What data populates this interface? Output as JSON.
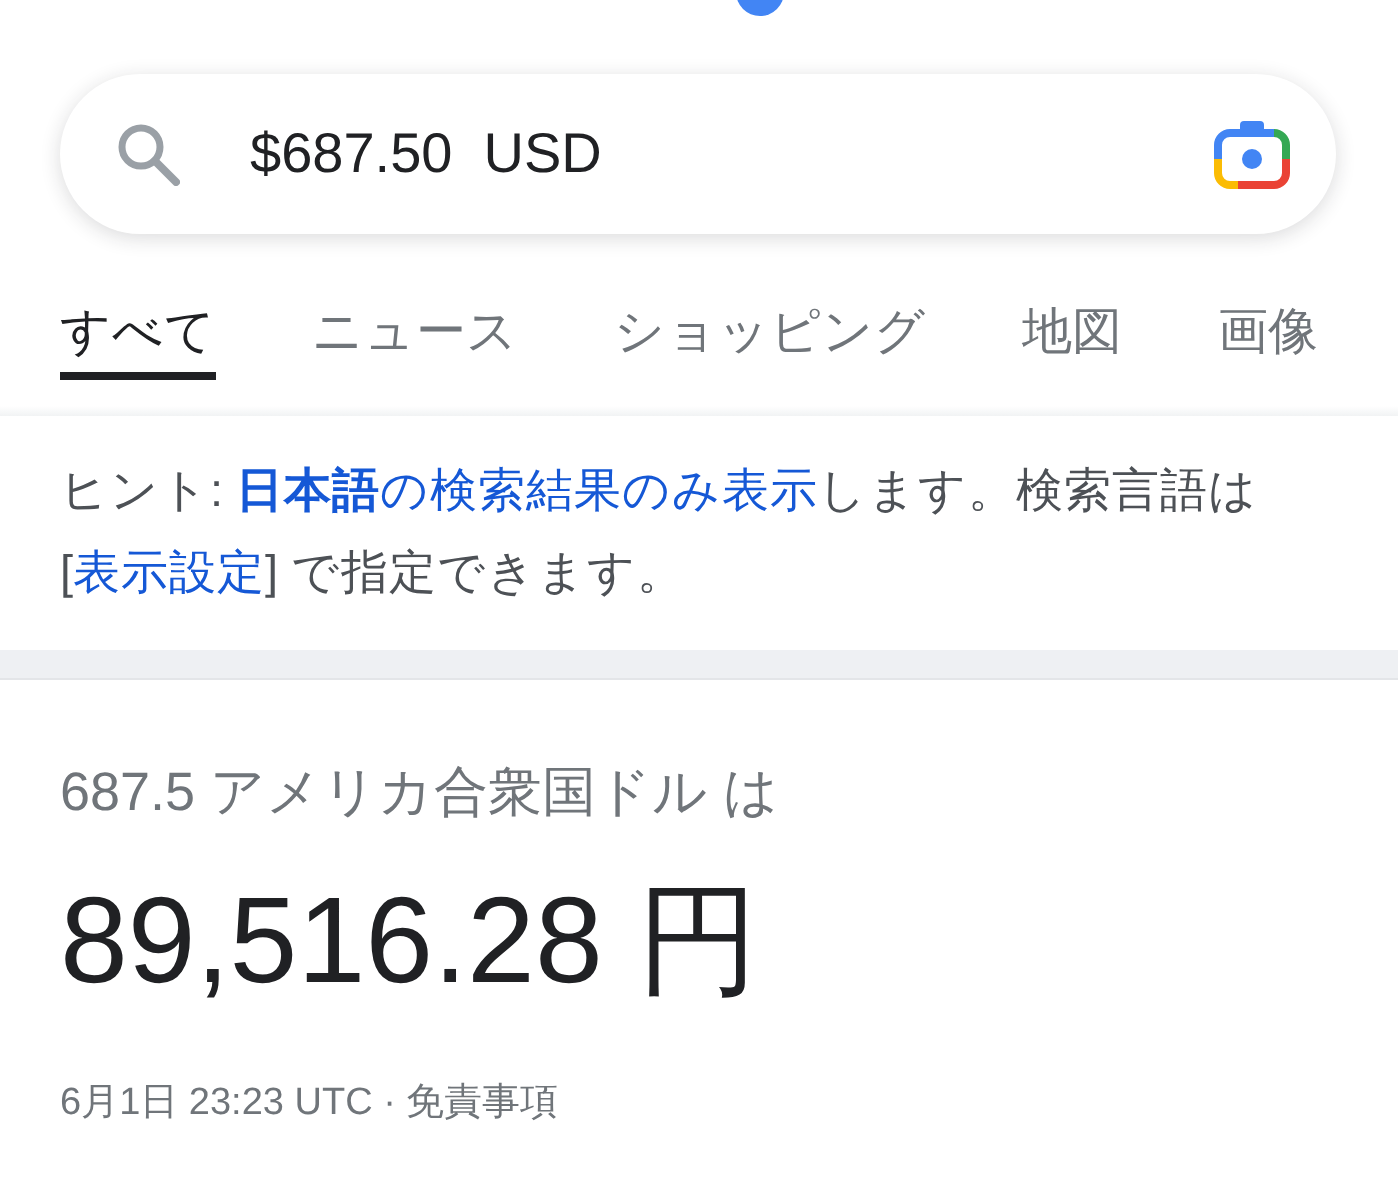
{
  "search": {
    "value": "$687.50  USD"
  },
  "tabs": [
    {
      "label": "すべて",
      "selected": true
    },
    {
      "label": "ニュース",
      "selected": false
    },
    {
      "label": "ショッピング",
      "selected": false
    },
    {
      "label": "地図",
      "selected": false
    },
    {
      "label": "画像",
      "selected": false
    }
  ],
  "hint": {
    "segments": [
      {
        "kind": "text",
        "text": "ヒント: "
      },
      {
        "kind": "link",
        "text": "**日本語**の検索結果のみ表示"
      },
      {
        "kind": "text",
        "text": "します。検索言語は ["
      },
      {
        "kind": "link",
        "text": "表示設定"
      },
      {
        "kind": "text",
        "text": "] で指定できます。"
      }
    ]
  },
  "result": {
    "query": "687.5 アメリカ合衆国ドル は",
    "amount": "89,516.28 円",
    "footer": {
      "time": "6月1日 23:23 UTC · ",
      "disclaimer": "免責事項"
    }
  }
}
